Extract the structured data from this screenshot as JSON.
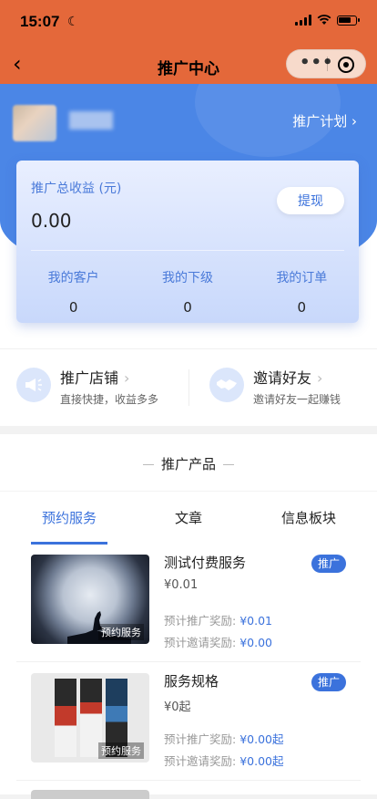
{
  "status_bar": {
    "time": "15:07"
  },
  "nav": {
    "title": "推广中心"
  },
  "header": {
    "plan_link": "推广计划"
  },
  "earnings": {
    "label": "推广总收益 (元)",
    "value": "0.00",
    "withdraw": "提现"
  },
  "stats": [
    {
      "label": "我的客户",
      "value": "0"
    },
    {
      "label": "我的下级",
      "value": "0"
    },
    {
      "label": "我的订单",
      "value": "0"
    }
  ],
  "shortcuts": [
    {
      "title": "推广店铺",
      "subtitle": "直接快捷，收益多多"
    },
    {
      "title": "邀请好友",
      "subtitle": "邀请好友一起赚钱"
    }
  ],
  "products_section": {
    "title": "推广产品",
    "tabs": [
      "预约服务",
      "文章",
      "信息板块"
    ],
    "items": [
      {
        "name": "测试付费服务",
        "price": "¥0.01",
        "badge": "推广",
        "thumb_tag": "预约服务",
        "reward_label": "预计推广奖励:",
        "reward": "¥0.01",
        "invite_label": "预计邀请奖励:",
        "invite": "¥0.00"
      },
      {
        "name": "服务规格",
        "price": "¥0起",
        "badge": "推广",
        "thumb_tag": "预约服务",
        "reward_label": "预计推广奖励:",
        "reward": "¥0.00起",
        "invite_label": "预计邀请奖励:",
        "invite": "¥0.00起"
      }
    ]
  },
  "colors": {
    "header": "#E4683A",
    "primary": "#3b72dc",
    "hero": "#4b86e6"
  }
}
